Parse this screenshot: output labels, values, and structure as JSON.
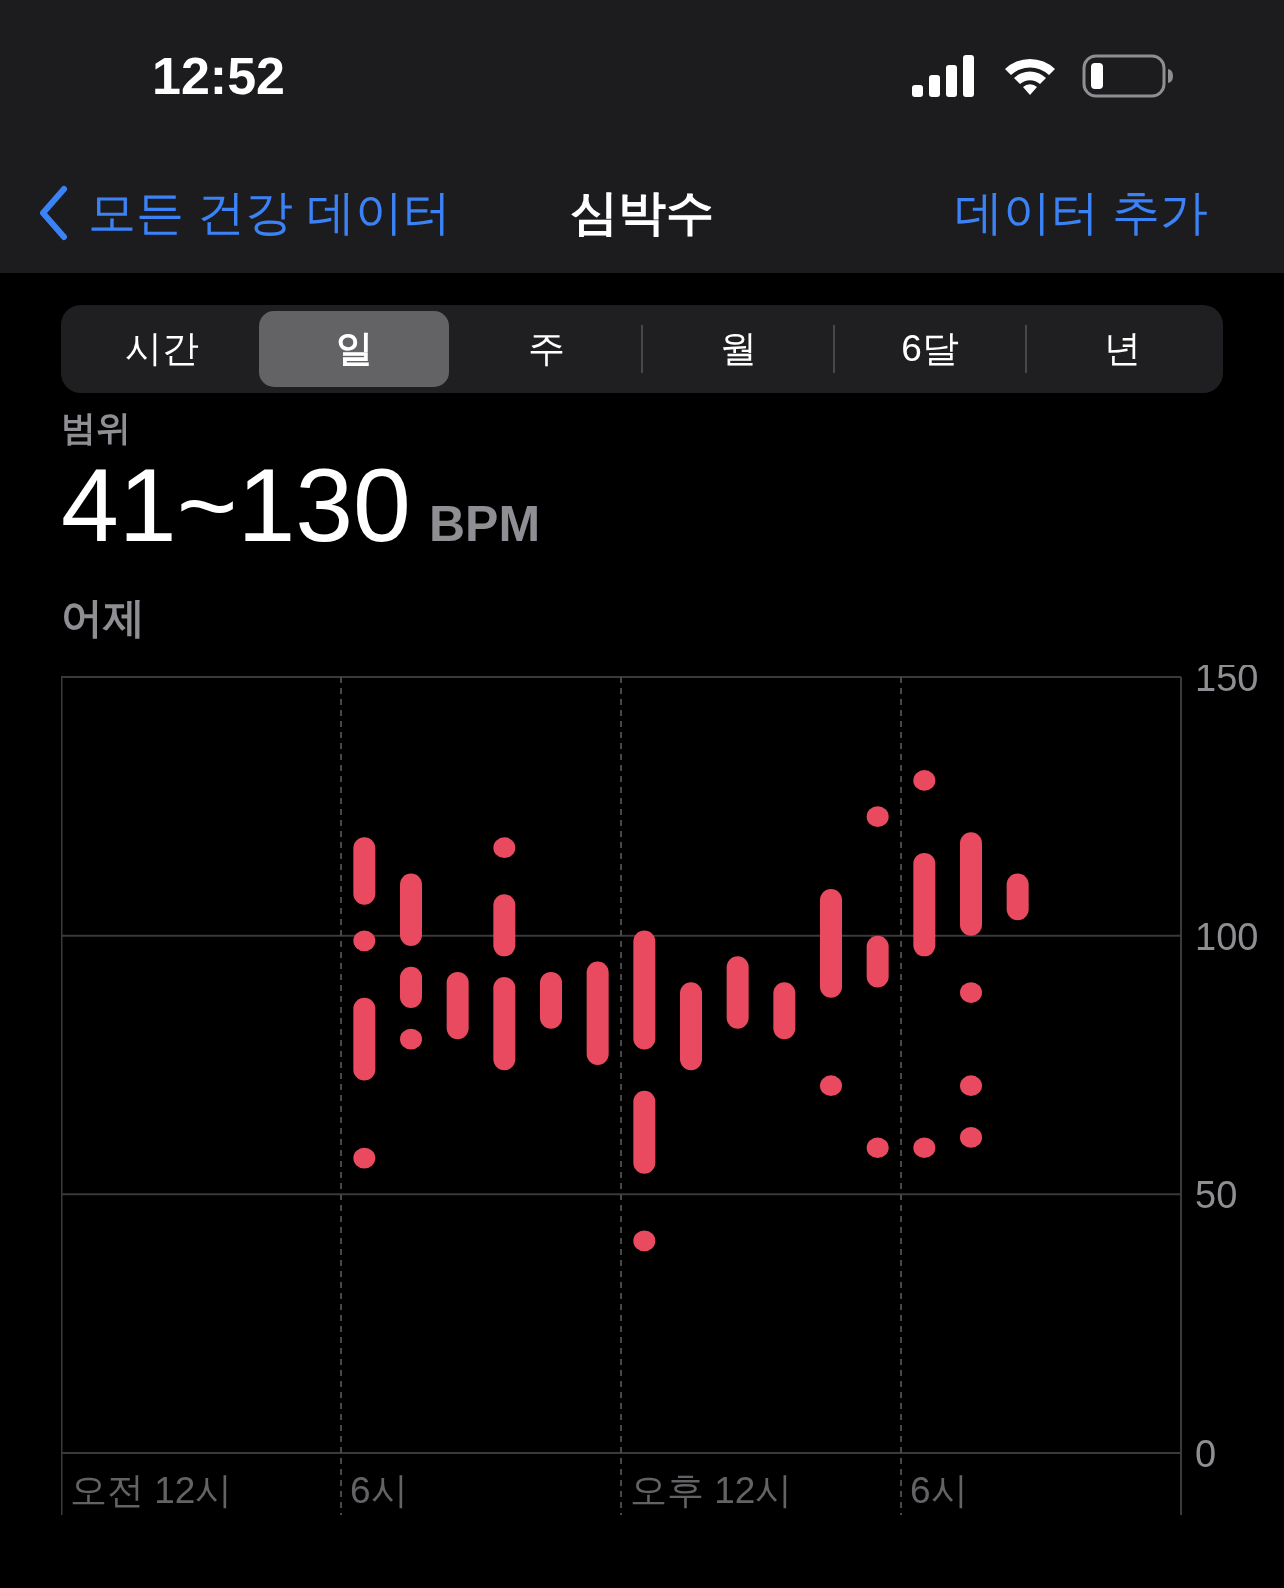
{
  "status_bar": {
    "time": "12:52"
  },
  "nav": {
    "back": "모든 건강 데이터",
    "title": "심박수",
    "action": "데이터 추가"
  },
  "segments": [
    {
      "label": "시간",
      "selected": false
    },
    {
      "label": "일",
      "selected": true
    },
    {
      "label": "주",
      "selected": false
    },
    {
      "label": "월",
      "selected": false
    },
    {
      "label": "6달",
      "selected": false
    },
    {
      "label": "년",
      "selected": false
    }
  ],
  "summary": {
    "label": "범위",
    "value": "41~130",
    "unit": "BPM",
    "date": "어제"
  },
  "chart": {
    "time_labels": [
      "오전 12시",
      "6시",
      "오후 12시",
      "6시"
    ],
    "chart_data": {
      "type": "candlestick",
      "grid": true,
      "ylim": [
        0,
        150
      ],
      "yticks": [
        0,
        50,
        100,
        150
      ],
      "categories": [
        null,
        null,
        null,
        null,
        null,
        null,
        null,
        null,
        null,
        null,
        null,
        null,
        null,
        null,
        null,
        null,
        null,
        null,
        null,
        null,
        null,
        null,
        null,
        null
      ],
      "series": [
        {
          "color": "#e94a5f",
          "ohlc": [
            null,
            null,
            null,
            null,
            null,
            null,
            [
              106,
              119,
              106,
              119
            ],
            [
              98,
              112,
              98,
              112
            ],
            [
              80,
              93,
              80,
              93
            ],
            [
              115,
              119,
              115,
              119
            ],
            [
              82,
              93,
              82,
              93
            ],
            [
              75,
              95,
              75,
              95
            ],
            [
              78,
              101,
              78,
              101
            ],
            [
              74,
              91,
              74,
              91
            ],
            [
              82,
              96,
              82,
              96
            ],
            [
              80,
              91,
              80,
              91
            ],
            [
              88,
              109,
              88,
              109
            ],
            [
              121,
              125,
              121,
              125
            ],
            [
              128,
              132,
              128,
              132
            ],
            [
              100,
              120,
              100,
              120
            ],
            [
              103,
              112,
              103,
              112
            ],
            null,
            null,
            null
          ]
        },
        {
          "color": "#e94a5f",
          "ohlc": [
            null,
            null,
            null,
            null,
            null,
            null,
            [
              97,
              101,
              97,
              101
            ],
            [
              86,
              94,
              86,
              94
            ],
            null,
            [
              96,
              108,
              96,
              108
            ],
            null,
            null,
            [
              54,
              70,
              54,
              70
            ],
            null,
            null,
            null,
            [
              69,
              73,
              69,
              73
            ],
            [
              90,
              100,
              90,
              100
            ],
            [
              96,
              116,
              96,
              116
            ],
            [
              87,
              91,
              87,
              91
            ],
            null,
            null,
            null,
            null
          ]
        },
        {
          "color": "#e94a5f",
          "ohlc": [
            null,
            null,
            null,
            null,
            null,
            null,
            [
              72,
              88,
              72,
              88
            ],
            [
              78,
              82,
              78,
              82
            ],
            null,
            [
              74,
              92,
              74,
              92
            ],
            null,
            null,
            [
              39,
              43,
              39,
              43
            ],
            null,
            null,
            null,
            null,
            [
              57,
              61,
              57,
              61
            ],
            [
              57,
              61,
              57,
              61
            ],
            [
              69,
              73,
              69,
              73
            ],
            null,
            null,
            null,
            null
          ]
        },
        {
          "color": "#e94a5f",
          "ohlc": [
            null,
            null,
            null,
            null,
            null,
            null,
            [
              55,
              59,
              55,
              59
            ],
            null,
            null,
            null,
            null,
            null,
            null,
            null,
            null,
            null,
            null,
            null,
            null,
            [
              59,
              63,
              59,
              63
            ],
            null,
            null,
            null,
            null
          ]
        }
      ]
    }
  }
}
